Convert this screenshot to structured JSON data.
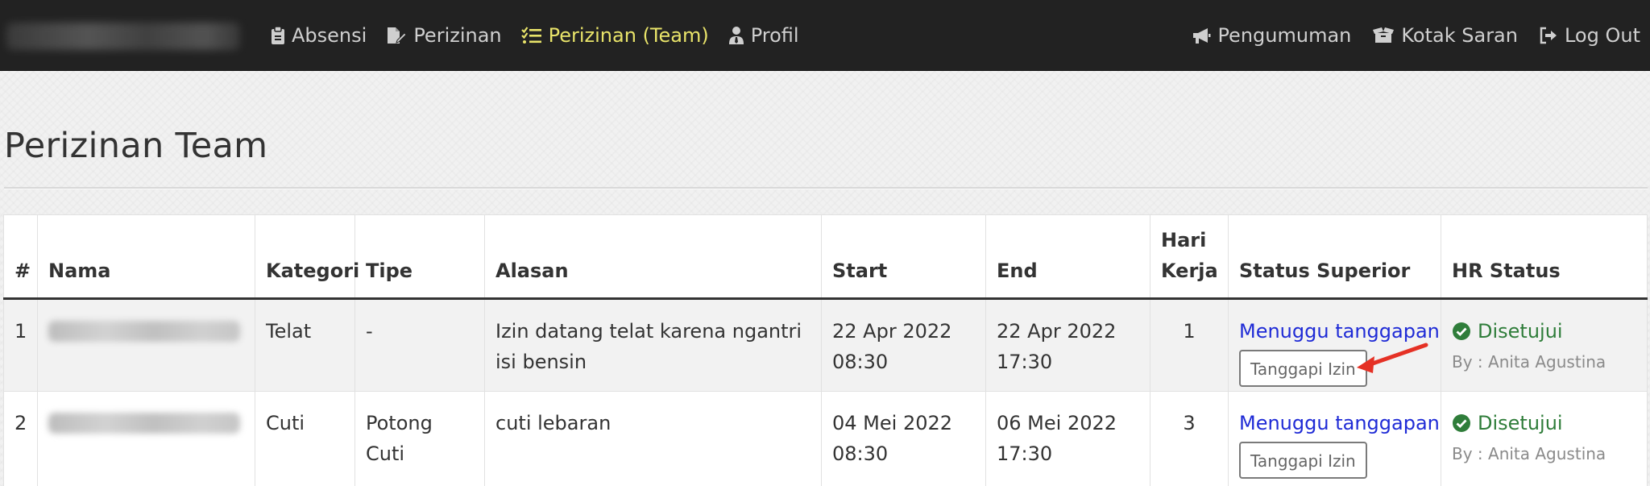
{
  "nav": {
    "items": [
      {
        "label": "Absensi",
        "icon": "clipboard-icon",
        "active": false
      },
      {
        "label": "Perizinan",
        "icon": "file-signature-icon",
        "active": false
      },
      {
        "label": "Perizinan (Team)",
        "icon": "tasks-icon",
        "active": true
      },
      {
        "label": "Profil",
        "icon": "user-tie-icon",
        "active": false
      }
    ],
    "right_items": [
      {
        "label": "Pengumuman",
        "icon": "bullhorn-icon"
      },
      {
        "label": "Kotak Saran",
        "icon": "box-icon"
      },
      {
        "label": "Log Out",
        "icon": "sign-out-icon"
      }
    ],
    "active_color": "#e9e46a"
  },
  "page": {
    "title": "Perizinan Team"
  },
  "table": {
    "headers": {
      "num": "#",
      "nama": "Nama",
      "kategori": "Kategori",
      "tipe": "Tipe",
      "alasan": "Alasan",
      "start": "Start",
      "end": "End",
      "hari_kerja": "Hari Kerja",
      "status_superior": "Status Superior",
      "hr_status": "HR Status"
    },
    "rows": [
      {
        "num": "1",
        "kategori": "Telat",
        "tipe": "-",
        "alasan": "Izin datang telat karena ngantri isi bensin",
        "start_date": "22 Apr 2022",
        "start_time": "08:30",
        "end_date": "22 Apr 2022",
        "end_time": "17:30",
        "hari_kerja": "1",
        "status_superior": "Menuggu tanggapan",
        "button_label": "Tanggapi Izin",
        "hr_status": "Disetujui",
        "hr_by": "By : Anita Agustina"
      },
      {
        "num": "2",
        "kategori": "Cuti",
        "tipe": "Potong Cuti",
        "alasan": "cuti lebaran",
        "start_date": "04 Mei 2022",
        "start_time": "08:30",
        "end_date": "06 Mei 2022",
        "end_time": "17:30",
        "hari_kerja": "3",
        "status_superior": "Menuggu tanggapan",
        "button_label": "Tanggapi Izin",
        "hr_status": "Disetujui",
        "hr_by": "By : Anita Agustina"
      }
    ]
  },
  "colors": {
    "navbar": "#222222",
    "link": "#1f2bd6",
    "approved": "#2f7d3a",
    "annotation_arrow": "#e53125"
  }
}
